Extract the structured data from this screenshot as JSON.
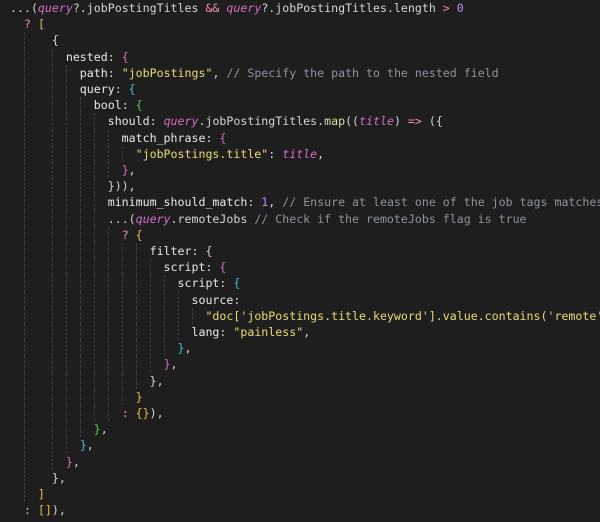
{
  "editor": {
    "lines": [
      {
        "tokens": [
          {
            "t": "...(",
            "c": "punct"
          },
          {
            "t": "query",
            "c": "var"
          },
          {
            "t": "?.jobPostingTitles ",
            "c": "plain"
          },
          {
            "t": "&&",
            "c": "op"
          },
          {
            "t": " ",
            "c": "plain"
          },
          {
            "t": "query",
            "c": "var"
          },
          {
            "t": "?.jobPostingTitles.length ",
            "c": "plain"
          },
          {
            "t": ">",
            "c": "op"
          },
          {
            "t": " ",
            "c": "plain"
          },
          {
            "t": "0",
            "c": "num"
          }
        ]
      },
      {
        "tokens": [
          {
            "t": "  ",
            "c": "plain"
          },
          {
            "t": "?",
            "c": "op"
          },
          {
            "t": " ",
            "c": "plain"
          },
          {
            "t": "[",
            "c": "gold"
          }
        ]
      },
      {
        "tokens": [
          {
            "t": "      {",
            "c": "plain"
          }
        ]
      },
      {
        "tokens": [
          {
            "t": "        nested",
            "c": "key"
          },
          {
            "t": ": ",
            "c": "plain"
          },
          {
            "t": "{",
            "c": "magenta"
          }
        ]
      },
      {
        "tokens": [
          {
            "t": "          path",
            "c": "key"
          },
          {
            "t": ": ",
            "c": "plain"
          },
          {
            "t": "\"jobPostings\"",
            "c": "str"
          },
          {
            "t": ", ",
            "c": "plain"
          },
          {
            "t": "// Specify the path to the nested field",
            "c": "comment"
          }
        ]
      },
      {
        "tokens": [
          {
            "t": "          query",
            "c": "key"
          },
          {
            "t": ": ",
            "c": "plain"
          },
          {
            "t": "{",
            "c": "cyan"
          }
        ]
      },
      {
        "tokens": [
          {
            "t": "            bool",
            "c": "key"
          },
          {
            "t": ": ",
            "c": "plain"
          },
          {
            "t": "{",
            "c": "green"
          }
        ]
      },
      {
        "tokens": [
          {
            "t": "              should",
            "c": "key"
          },
          {
            "t": ": ",
            "c": "plain"
          },
          {
            "t": "query",
            "c": "var"
          },
          {
            "t": ".jobPostingTitles.",
            "c": "plain"
          },
          {
            "t": "map",
            "c": "fn"
          },
          {
            "t": "((",
            "c": "plain"
          },
          {
            "t": "title",
            "c": "var"
          },
          {
            "t": ") ",
            "c": "plain"
          },
          {
            "t": "=>",
            "c": "op"
          },
          {
            "t": " ({",
            "c": "plain"
          }
        ]
      },
      {
        "tokens": [
          {
            "t": "                match_phrase",
            "c": "key"
          },
          {
            "t": ": ",
            "c": "plain"
          },
          {
            "t": "{",
            "c": "magenta"
          }
        ]
      },
      {
        "tokens": [
          {
            "t": "                  ",
            "c": "plain"
          },
          {
            "t": "\"jobPostings.title\"",
            "c": "str"
          },
          {
            "t": ": ",
            "c": "plain"
          },
          {
            "t": "title",
            "c": "var"
          },
          {
            "t": ",",
            "c": "plain"
          }
        ]
      },
      {
        "tokens": [
          {
            "t": "                ",
            "c": "plain"
          },
          {
            "t": "}",
            "c": "magenta"
          },
          {
            "t": ",",
            "c": "plain"
          }
        ]
      },
      {
        "tokens": [
          {
            "t": "              })),",
            "c": "plain"
          }
        ]
      },
      {
        "tokens": [
          {
            "t": "              minimum_should_match",
            "c": "key"
          },
          {
            "t": ": ",
            "c": "plain"
          },
          {
            "t": "1",
            "c": "num"
          },
          {
            "t": ", ",
            "c": "plain"
          },
          {
            "t": "// Ensure at least one of the job tags matches",
            "c": "comment"
          }
        ]
      },
      {
        "tokens": [
          {
            "t": "              ...(",
            "c": "plain"
          },
          {
            "t": "query",
            "c": "var"
          },
          {
            "t": ".remoteJobs ",
            "c": "plain"
          },
          {
            "t": "// Check if the remoteJobs flag is true",
            "c": "comment"
          }
        ]
      },
      {
        "tokens": [
          {
            "t": "                ",
            "c": "plain"
          },
          {
            "t": "?",
            "c": "op"
          },
          {
            "t": " ",
            "c": "plain"
          },
          {
            "t": "{",
            "c": "gold"
          }
        ]
      },
      {
        "tokens": [
          {
            "t": "                    filter",
            "c": "key"
          },
          {
            "t": ": ",
            "c": "plain"
          },
          {
            "t": "{",
            "c": "plain"
          }
        ]
      },
      {
        "tokens": [
          {
            "t": "                      script",
            "c": "key"
          },
          {
            "t": ": ",
            "c": "plain"
          },
          {
            "t": "{",
            "c": "magenta"
          }
        ]
      },
      {
        "tokens": [
          {
            "t": "                        script",
            "c": "key"
          },
          {
            "t": ": ",
            "c": "plain"
          },
          {
            "t": "{",
            "c": "cyan"
          }
        ]
      },
      {
        "tokens": [
          {
            "t": "                          source",
            "c": "key"
          },
          {
            "t": ":",
            "c": "plain"
          }
        ]
      },
      {
        "tokens": [
          {
            "t": "                            ",
            "c": "plain"
          },
          {
            "t": "\"doc['jobPostings.title.keyword'].value.contains('remote')\"",
            "c": "str"
          },
          {
            "t": ",",
            "c": "plain"
          }
        ]
      },
      {
        "tokens": [
          {
            "t": "                          lang",
            "c": "key"
          },
          {
            "t": ": ",
            "c": "plain"
          },
          {
            "t": "\"painless\"",
            "c": "str"
          },
          {
            "t": ",",
            "c": "plain"
          }
        ]
      },
      {
        "tokens": [
          {
            "t": "                        ",
            "c": "plain"
          },
          {
            "t": "}",
            "c": "cyan"
          },
          {
            "t": ",",
            "c": "plain"
          }
        ]
      },
      {
        "tokens": [
          {
            "t": "                      ",
            "c": "plain"
          },
          {
            "t": "}",
            "c": "magenta"
          },
          {
            "t": ",",
            "c": "plain"
          }
        ]
      },
      {
        "tokens": [
          {
            "t": "                    },",
            "c": "plain"
          }
        ]
      },
      {
        "tokens": [
          {
            "t": "                  ",
            "c": "plain"
          },
          {
            "t": "}",
            "c": "gold"
          }
        ]
      },
      {
        "tokens": [
          {
            "t": "                ",
            "c": "plain"
          },
          {
            "t": ":",
            "c": "op"
          },
          {
            "t": " ",
            "c": "plain"
          },
          {
            "t": "{}",
            "c": "gold"
          },
          {
            "t": "),",
            "c": "plain"
          }
        ]
      },
      {
        "tokens": [
          {
            "t": "            ",
            "c": "plain"
          },
          {
            "t": "}",
            "c": "green"
          },
          {
            "t": ",",
            "c": "plain"
          }
        ]
      },
      {
        "tokens": [
          {
            "t": "          ",
            "c": "plain"
          },
          {
            "t": "}",
            "c": "cyan"
          },
          {
            "t": ",",
            "c": "plain"
          }
        ]
      },
      {
        "tokens": [
          {
            "t": "        ",
            "c": "plain"
          },
          {
            "t": "}",
            "c": "magenta"
          },
          {
            "t": ",",
            "c": "plain"
          }
        ]
      },
      {
        "tokens": [
          {
            "t": "      },",
            "c": "plain"
          }
        ]
      },
      {
        "tokens": [
          {
            "t": "    ",
            "c": "plain"
          },
          {
            "t": "]",
            "c": "gold"
          }
        ]
      },
      {
        "tokens": [
          {
            "t": "  ",
            "c": "plain"
          },
          {
            "t": ":",
            "c": "op"
          },
          {
            "t": " ",
            "c": "plain"
          },
          {
            "t": "[]",
            "c": "gold"
          },
          {
            "t": "),",
            "c": "plain"
          }
        ]
      }
    ]
  }
}
